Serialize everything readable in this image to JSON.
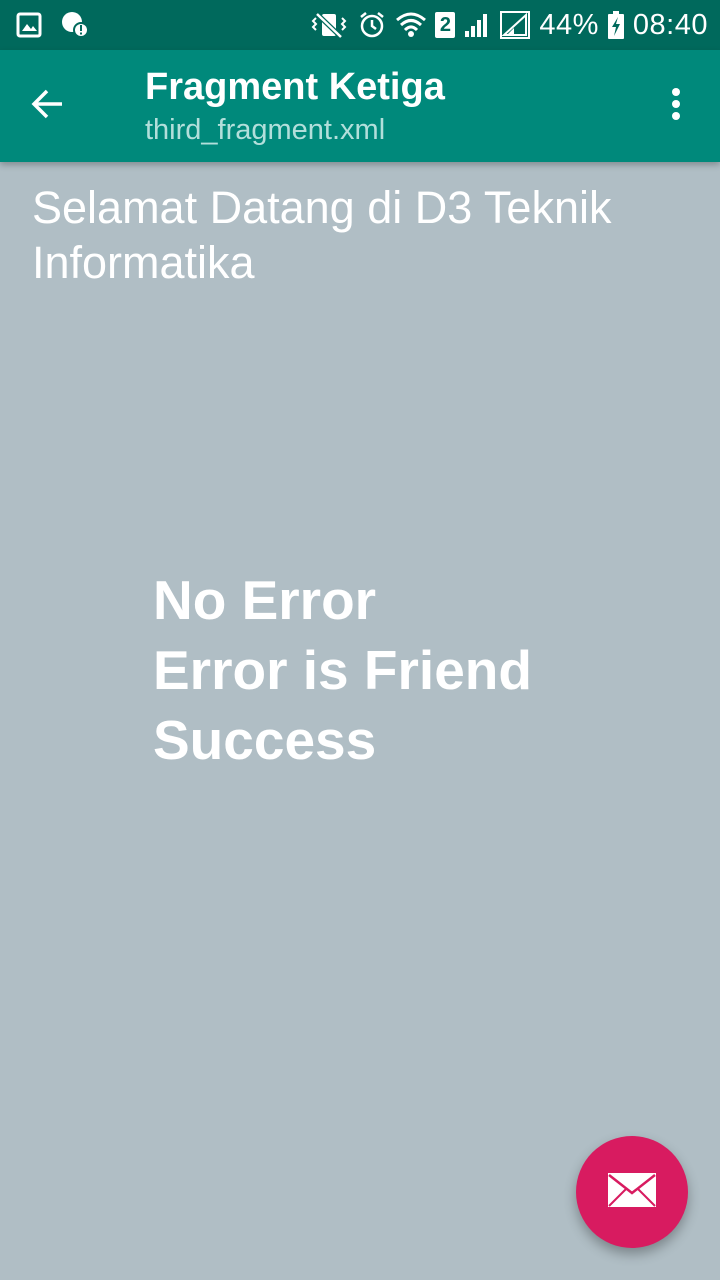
{
  "status_bar": {
    "battery_percent": "44%",
    "time": "08:40",
    "sim_slot": "2",
    "icons": [
      "image-icon",
      "notification-alert-icon",
      "vibrate-mute-icon",
      "alarm-icon",
      "wifi-icon",
      "signal-icon",
      "signal-icon-2",
      "battery-charging-icon"
    ]
  },
  "app_bar": {
    "title": "Fragment Ketiga",
    "subtitle": "third_fragment.xml",
    "back_icon": "arrow-back-icon",
    "menu_icon": "more-vert-icon"
  },
  "content": {
    "welcome": "Selamat Datang di D3 Teknik Informatika",
    "motto": [
      "No Error",
      "Error is Friend",
      "Success"
    ]
  },
  "fab": {
    "icon": "mail-icon"
  },
  "colors": {
    "status_bar": "#00695c",
    "app_bar": "#00897b",
    "background": "#b0bec5",
    "fab": "#d81b60",
    "text": "#ffffff"
  }
}
